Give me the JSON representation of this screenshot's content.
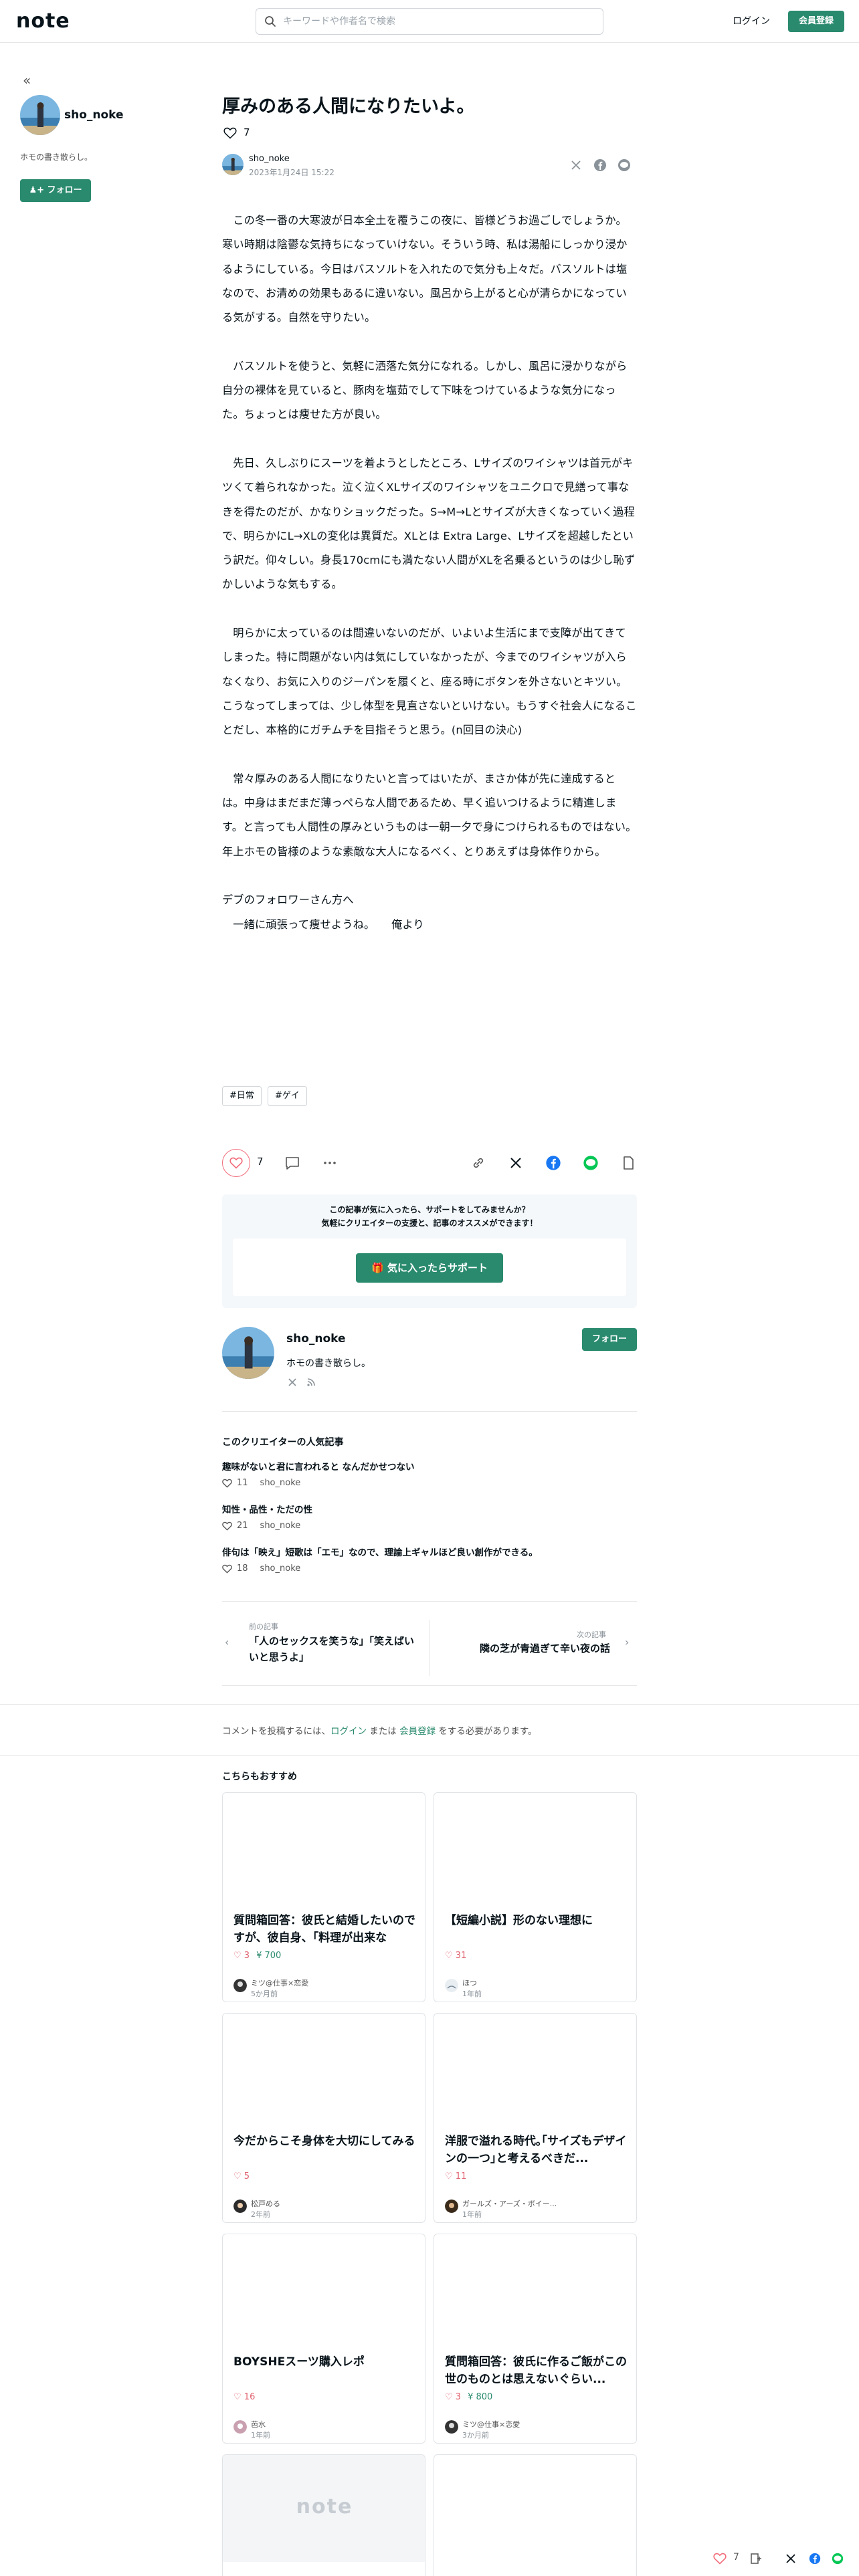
{
  "header": {
    "logo": "note",
    "search_placeholder": "キーワードや作者名で検索",
    "login": "ログイン",
    "signup": "会員登録"
  },
  "sidebar": {
    "name": "sho_noke",
    "bio": "ホモの書き散らし。",
    "follow": "フォロー"
  },
  "article": {
    "title": "厚みのある人間になりたいよ。",
    "like_count": "7",
    "author": "sho_noke",
    "date": "2023年1月24日 15:22",
    "paragraphs": [
      "この冬一番の大寒波が日本全土を覆うこの夜に、皆様どうお過ごしでしょうか。寒い時期は陰鬱な気持ちになっていけない。そういう時、私は湯船にしっかり浸かるようにしている。今日はバスソルトを入れたので気分も上々だ。バスソルトは塩なので、お清めの効果もあるに違いない。風呂から上がると心が清らかになっている気がする。自然を守りたい。",
      "バスソルトを使うと、気軽に洒落た気分になれる。しかし、風呂に浸かりながら自分の裸体を見ていると、豚肉を塩茹でして下味をつけているような気分になった。ちょっとは痩せた方が良い。",
      "先日、久しぶりにスーツを着ようとしたところ、Lサイズのワイシャツは首元がキツくて着られなかった。泣く泣くXLサイズのワイシャツをユニクロで見繕って事なきを得たのだが、かなりショックだった。S→M→Lとサイズが大きくなっていく過程で、明らかにL→XLの変化は異質だ。XLとは Extra Large、Lサイズを超越したという訳だ。仰々しい。身長170cmにも満たない人間がXLを名乗るというのは少し恥ずかしいような気もする。",
      "明らかに太っているのは間違いないのだが、いよいよ生活にまで支障が出てきてしまった。特に問題がない内は気にしていなかったが、今までのワイシャツが入らなくなり、お気に入りのジーパンを履くと、座る時にボタンを外さないとキツい。こうなってしまっては、少し体型を見直さないといけない。もうすぐ社会人になることだし、本格的にガチムチを目指そうと思う。(n回目の決心)",
      "常々厚みのある人間になりたいと言ってはいたが、まさか体が先に達成するとは。中身はまだまだ薄っぺらな人間であるため、早く追いつけるように精進します。と言っても人間性の厚みというものは一朝一夕で身につけられるものではない。年上ホモの皆様のような素敵な大人になるべく、とりあえずは身体作りから。"
    ],
    "closing_1": "デブのフォロワーさん方へ",
    "closing_2": "一緒に頑張って痩せようね。　　俺より"
  },
  "tags": [
    "#日常",
    "#ゲイ"
  ],
  "actions": {
    "like_count": "7"
  },
  "support": {
    "line1": "この記事が気に入ったら、サポートをしてみませんか？",
    "line2": "気軽にクリエイターの支援と、記事のオススメができます！",
    "button": "気に入ったらサポート"
  },
  "creator": {
    "name": "sho_noke",
    "bio": "ホモの書き散らし。",
    "follow": "フォロー"
  },
  "popular": {
    "heading": "このクリエイターの人気記事",
    "items": [
      {
        "title": "趣味がないと君に言われると なんだかせつない",
        "likes": "11",
        "user": "sho_noke"
      },
      {
        "title": "知性・品性・ただの性",
        "likes": "21",
        "user": "sho_noke"
      },
      {
        "title": "俳句は「映え」短歌は「エモ」なので、理論上ギャルほど良い創作ができる。",
        "likes": "18",
        "user": "sho_noke"
      }
    ]
  },
  "nav": {
    "prev_label": "前の記事",
    "prev_title": "「人のセックスを笑うな」「笑えばいいと思うよ」",
    "next_label": "次の記事",
    "next_title": "隣の芝が青過ぎて辛い夜の話"
  },
  "comment": {
    "pre": "コメントを投稿するには、",
    "login": "ログイン",
    "mid": " または ",
    "signup": "会員登録",
    "post": " をする必要があります。"
  },
  "recommend": {
    "heading": "こちらもおすすめ",
    "cards": [
      {
        "title": "質問箱回答：彼氏と結婚したいのですが、彼自身、｢料理が出来ない｣...",
        "likes": "3",
        "yen": "700",
        "author": "ミツ@仕事×恋愛",
        "date": "5か月前"
      },
      {
        "title": "【短編小説】形のない理想に",
        "likes": "31",
        "yen": "",
        "author": "ほつ",
        "date": "1年前"
      },
      {
        "title": "今だからこそ身体を大切にしてみる",
        "likes": "5",
        "yen": "",
        "author": "松戸める",
        "date": "2年前"
      },
      {
        "title": "洋服で溢れる時代｡｢サイズもデザインの一つ｣と考えるべきだ...",
        "likes": "11",
        "yen": "",
        "author": "ガールズ・アーズ・ボイー...",
        "date": "1年前"
      },
      {
        "title": "BOYSHEスーツ購入レポ",
        "likes": "16",
        "yen": "",
        "author": "芭水",
        "date": "1年前"
      },
      {
        "title": "質問箱回答：彼氏に作るご飯がこの世のものとは思えないぐらい...",
        "likes": "3",
        "yen": "800",
        "author": "ミツ@仕事×恋愛",
        "date": "3か月前"
      }
    ],
    "placeholder_logo": "note"
  },
  "floating": {
    "like_count": "7"
  },
  "colors": {
    "accent": "#2a8a6e",
    "like": "#f26b7a"
  }
}
